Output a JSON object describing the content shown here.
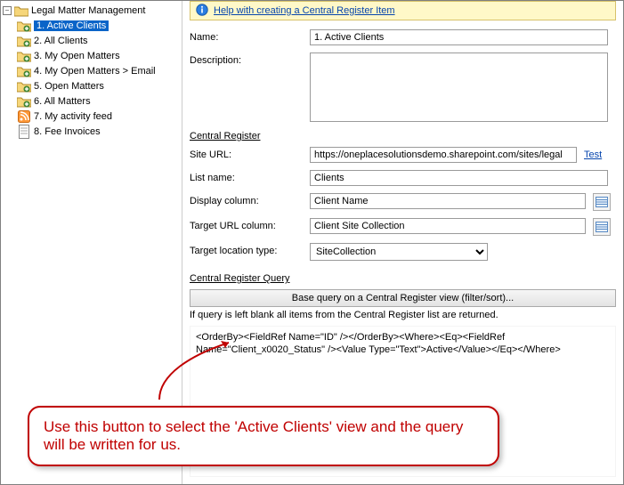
{
  "tree": {
    "root": "Legal Matter Management",
    "items": [
      {
        "label": "1. Active Clients",
        "icon": "section",
        "selected": true
      },
      {
        "label": "2. All Clients",
        "icon": "section"
      },
      {
        "label": "3. My Open Matters",
        "icon": "section"
      },
      {
        "label": "4. My Open Matters > Email",
        "icon": "section"
      },
      {
        "label": "5. Open Matters",
        "icon": "section"
      },
      {
        "label": "6. All Matters",
        "icon": "section"
      },
      {
        "label": "7. My activity feed",
        "icon": "feed"
      },
      {
        "label": "8. Fee Invoices",
        "icon": "invoice"
      }
    ]
  },
  "help_link": "Help with creating a Central Register Item",
  "form": {
    "name_label": "Name:",
    "name_value": "1. Active Clients",
    "desc_label": "Description:",
    "desc_value": "",
    "section_cr": "Central Register",
    "site_url_label": "Site URL:",
    "site_url_value": "https://oneplacesolutionsdemo.sharepoint.com/sites/legal",
    "test_link": "Test",
    "list_name_label": "List name:",
    "list_name_value": "Clients",
    "display_col_label": "Display column:",
    "display_col_value": "Client Name",
    "target_url_label": "Target URL column:",
    "target_url_value": "Client Site Collection",
    "target_loc_label": "Target location type:",
    "target_loc_value": "SiteCollection",
    "section_query": "Central Register Query",
    "base_query_btn": "Base query on a Central Register view (filter/sort)...",
    "query_note": "If query is left blank all items from the Central Register list are returned.",
    "query_value": "<OrderBy><FieldRef Name=\"ID\" /></OrderBy><Where><Eq><FieldRef Name=\"Client_x0020_Status\" /><Value Type=\"Text\">Active</Value></Eq></Where>"
  },
  "callout": "Use this button to select the 'Active Clients' view and the query will be written for us."
}
